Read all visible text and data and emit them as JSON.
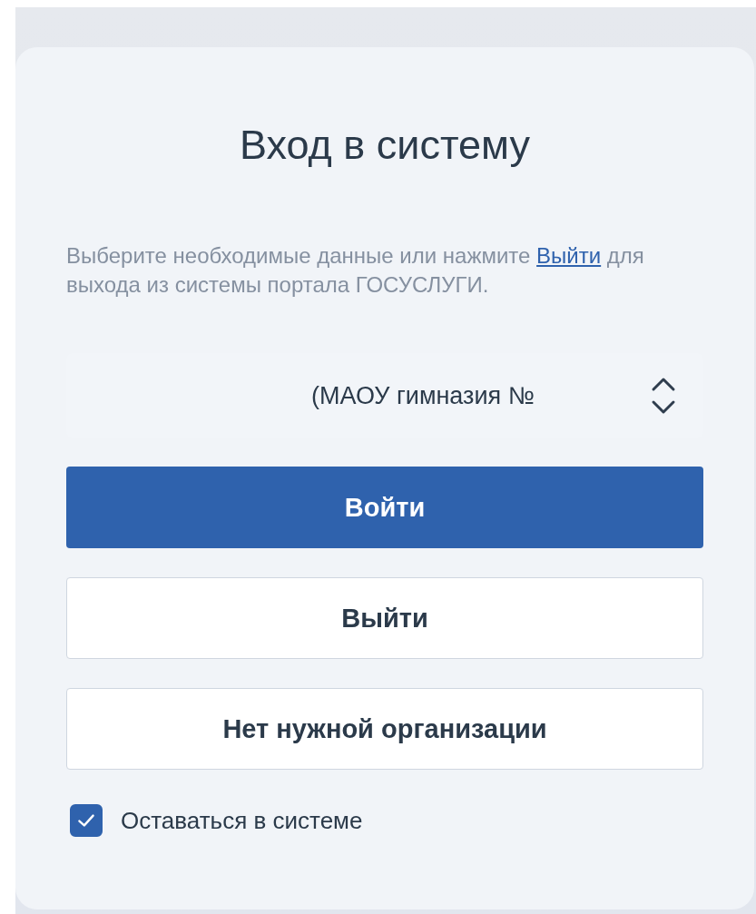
{
  "title": "Вход в систему",
  "intro": {
    "before": "Выберите необходимые данные или нажмите",
    "link": "Выйти",
    "after": "для выхода из системы портала ГОСУСЛУГИ."
  },
  "organization_select": {
    "value": "(МАОУ гимназия №"
  },
  "buttons": [
    {
      "label": "Войти",
      "kind": "primary"
    },
    {
      "label": "Выйти",
      "kind": "secondary"
    },
    {
      "label": "Нет нужной организации",
      "kind": "secondary"
    }
  ],
  "stay_signed_in": {
    "label": "Оставаться в системе",
    "checked": true
  }
}
